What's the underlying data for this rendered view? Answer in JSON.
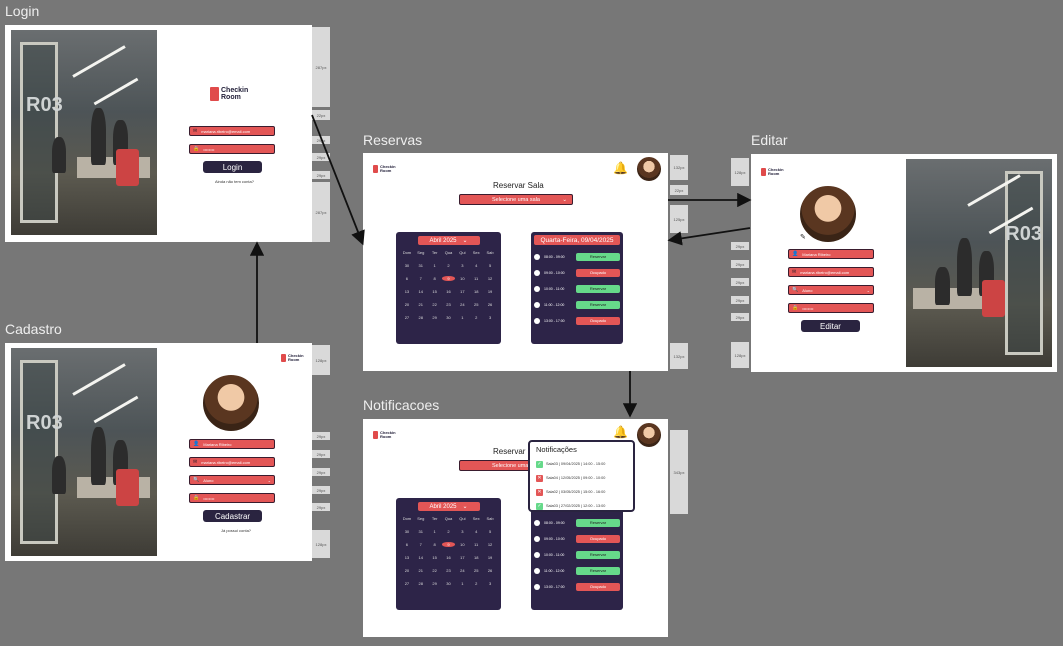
{
  "frames": {
    "login": "Login",
    "cadastro": "Cadastro",
    "reservas": "Reservas",
    "editar": "Editar",
    "notificacoes": "Notificacoes"
  },
  "logo": {
    "line1": "Checkin",
    "line2": "Room"
  },
  "photo_label": "R03",
  "login": {
    "email": "mariana.ribeiro@email.com",
    "password": "••••••••",
    "button": "Login",
    "link": "Ainda não tem conta?"
  },
  "cadastro": {
    "name": "Mariana Ribeiro",
    "email": "mariana.ribeiro@email.com",
    "role": "Aluno",
    "password": "••••••••",
    "button": "Cadastrar",
    "link": "Já possui conta?"
  },
  "editar": {
    "name": "Mariana Ribeiro",
    "email": "mariana.ribeiro@email.com",
    "role": "Aluno",
    "password": "••••••••",
    "button": "Editar"
  },
  "reservas": {
    "title": "Reservar Sala",
    "select": "Selecione uma sala",
    "month": "Abril 2025",
    "weekdays": [
      "Dom",
      "Seg",
      "Ter",
      "Qua",
      "Qui",
      "Sex",
      "Sab"
    ],
    "days": [
      "30",
      "31",
      "1",
      "2",
      "3",
      "4",
      "5",
      "6",
      "7",
      "8",
      "9",
      "10",
      "11",
      "12",
      "13",
      "14",
      "15",
      "16",
      "17",
      "18",
      "19",
      "20",
      "21",
      "22",
      "23",
      "24",
      "25",
      "26",
      "27",
      "28",
      "29",
      "30",
      "1",
      "2",
      "3"
    ],
    "selected_day": "9",
    "day_header": "Quarta-Feira, 09/04/2025",
    "slots": [
      {
        "time": "08:00 - 09:00",
        "status": "Reservar"
      },
      {
        "time": "09:00 - 10:00",
        "status": "Ocupado"
      },
      {
        "time": "10:00 - 11:00",
        "status": "Reservar"
      },
      {
        "time": "11:00 - 12:00",
        "status": "Reservar"
      },
      {
        "time": "13:00 - 17:00",
        "status": "Ocupado"
      }
    ]
  },
  "notificacoes": {
    "title": "Notificações",
    "items": [
      {
        "text": "Sala03 | 09/04/2025 | 14:00 - 15:00",
        "ok": true
      },
      {
        "text": "Sala04 | 12/05/2025 | 09:00 - 10:00",
        "ok": false
      },
      {
        "text": "Sala02 | 03/05/2025 | 15:00 - 16:00",
        "ok": false
      },
      {
        "text": "Sala03 | 27/02/2025 | 12:00 - 13:00",
        "ok": true
      }
    ]
  },
  "specs": {
    "login": [
      "287px",
      "22px",
      "29px",
      "29px",
      "29px",
      "287px"
    ],
    "cadastro": [
      "128px",
      "29px",
      "29px",
      "29px",
      "29px",
      "29px",
      "128px"
    ],
    "reservas": [
      "132px",
      "22px",
      "125px",
      "132px"
    ],
    "editar": [
      "128px",
      "29px",
      "29px",
      "29px",
      "29px",
      "29px",
      "128px"
    ],
    "notificacoes": [
      "343px"
    ]
  },
  "colors": {
    "accent": "#e35656",
    "dark": "#2a2440",
    "ok": "#66d98a"
  }
}
